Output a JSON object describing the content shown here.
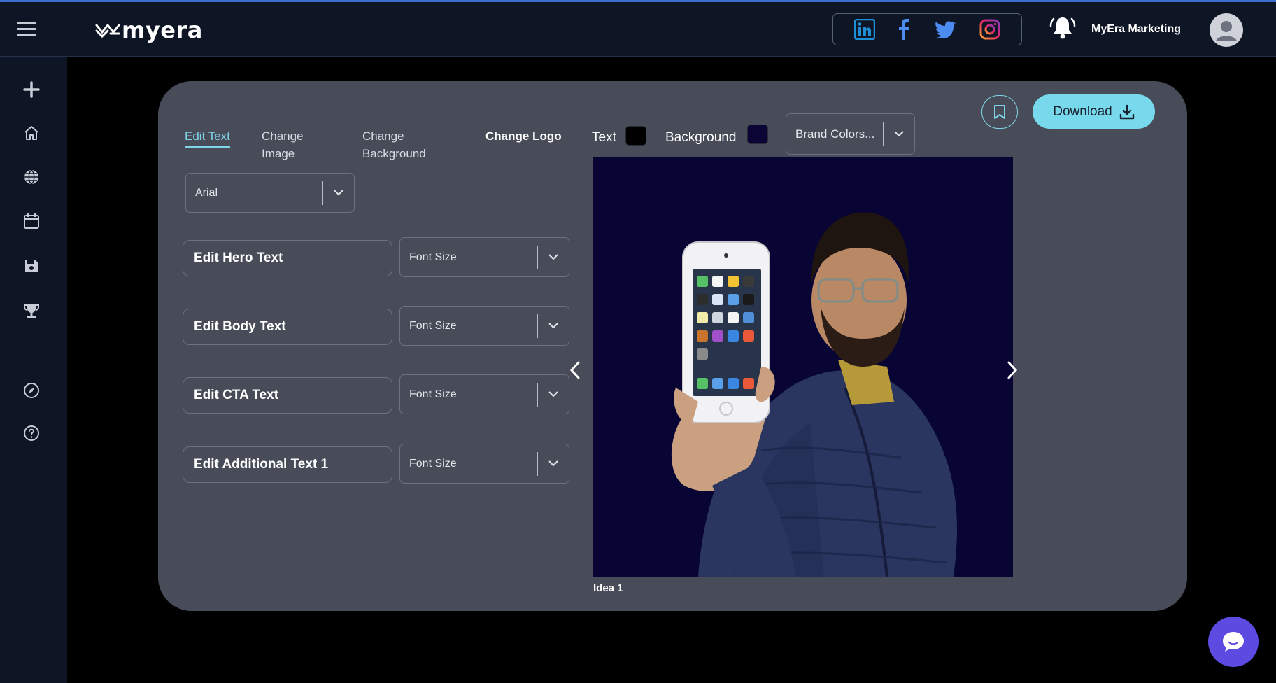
{
  "header": {
    "brand_name": "myera",
    "account_name": "MyEra Marketing"
  },
  "social": [
    "linkedin-icon",
    "facebook-icon",
    "twitter-icon",
    "instagram-icon"
  ],
  "sidebar": {
    "icons": [
      "plus-icon",
      "home-icon",
      "globe-icon",
      "calendar-icon",
      "save-icon",
      "trophy-icon",
      "compass-icon",
      "help-icon"
    ]
  },
  "tabs": [
    {
      "label": "Edit Text",
      "active": true
    },
    {
      "label": "Change Image"
    },
    {
      "label": "Change Background"
    },
    {
      "label": "Change Logo"
    }
  ],
  "font_family": {
    "value": "Arial"
  },
  "text_fields": [
    {
      "label": "Edit Hero Text",
      "size_placeholder": "Font Size"
    },
    {
      "label": "Edit Body Text",
      "size_placeholder": "Font Size"
    },
    {
      "label": "Edit CTA Text",
      "size_placeholder": "Font Size"
    },
    {
      "label": "Edit Additional Text 1",
      "size_placeholder": "Font Size"
    }
  ],
  "colors": {
    "text_label": "Text",
    "text_color": "#000000",
    "background_label": "Background",
    "background_color": "#0b0535",
    "brand_colors_value": "Brand Colors..."
  },
  "actions": {
    "download_label": "Download"
  },
  "preview": {
    "caption": "Idea 1"
  },
  "theme": {
    "accent": "#79d9ec",
    "panel": "#484c58",
    "chat": "#5d4ae0"
  }
}
